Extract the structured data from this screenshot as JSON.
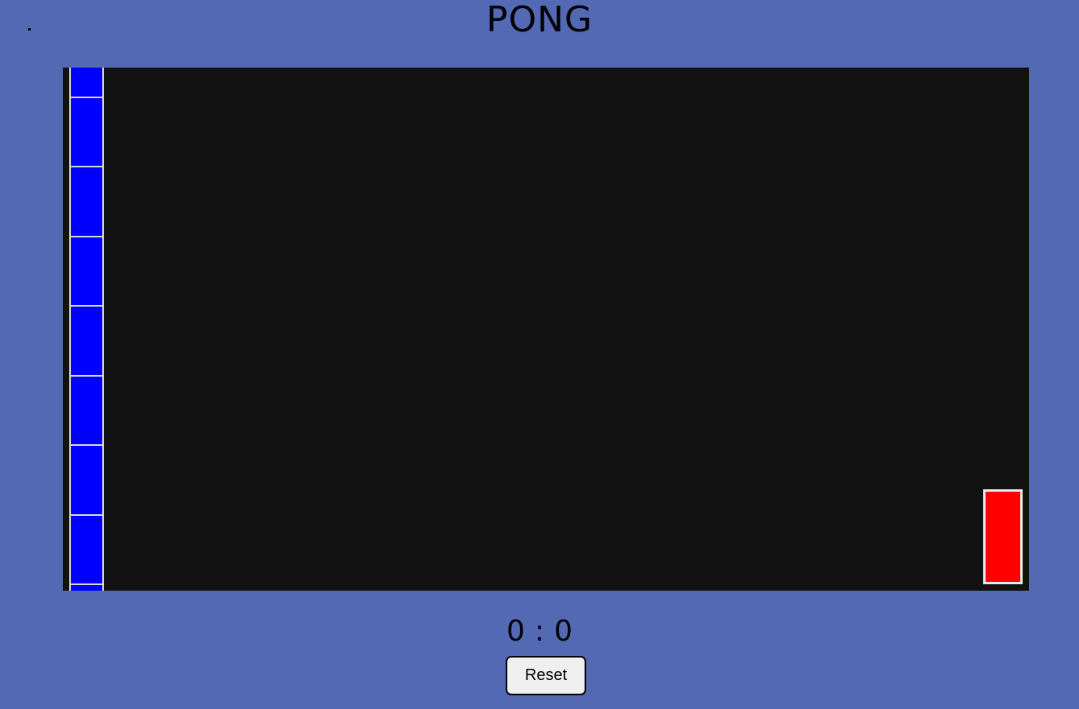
{
  "header": {
    "title": "PONG"
  },
  "game": {
    "board_color": "#121212",
    "brick_color": "#0000ff",
    "paddle_color": "#ff0000",
    "brick_count": 9
  },
  "score": {
    "left": "0",
    "separator": ":",
    "right": "0"
  },
  "controls": {
    "reset_label": "Reset"
  }
}
